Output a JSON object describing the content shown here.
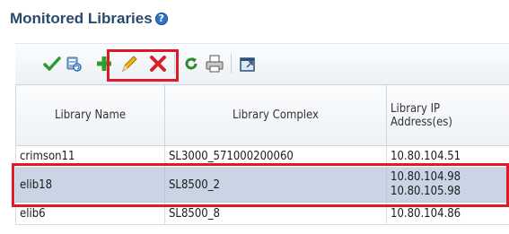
{
  "panel": {
    "title": "Monitored Libraries",
    "help_symbol": "?"
  },
  "toolbar": {
    "buttons": [
      {
        "icon": "check-icon",
        "color": "#2e9a2e"
      },
      {
        "icon": "refresh-library-icon",
        "color": "#2d6fb5"
      },
      {
        "icon": "add-icon",
        "color": "#2aa02a"
      },
      {
        "icon": "edit-pencil-icon",
        "color": "#e1a400"
      },
      {
        "icon": "delete-x-icon",
        "color": "#d8202a"
      },
      {
        "icon": "refresh-icon",
        "color": "#2e8a2e"
      },
      {
        "icon": "print-icon",
        "color": "#555555"
      },
      {
        "icon": "detach-icon",
        "color": "#2d6fb5"
      }
    ]
  },
  "table": {
    "columns": [
      "Library Name",
      "Library Complex",
      "Library IP\nAddress(es)"
    ],
    "rows": [
      {
        "name": "crimson11",
        "complex": "SL3000_571000200060",
        "ip1": "10.80.104.51",
        "ip2": ""
      },
      {
        "name": "elib18",
        "complex": "SL8500_2",
        "ip1": "10.80.104.98",
        "ip2": "10.80.105.98",
        "selected": true
      },
      {
        "name": "elib6",
        "complex": "SL8500_8",
        "ip1": "10.80.104.86",
        "ip2": ""
      }
    ]
  },
  "colors": {
    "highlight": "#e0192a",
    "selected_row": "#c9d4e4",
    "title": "#2a4a6c"
  }
}
